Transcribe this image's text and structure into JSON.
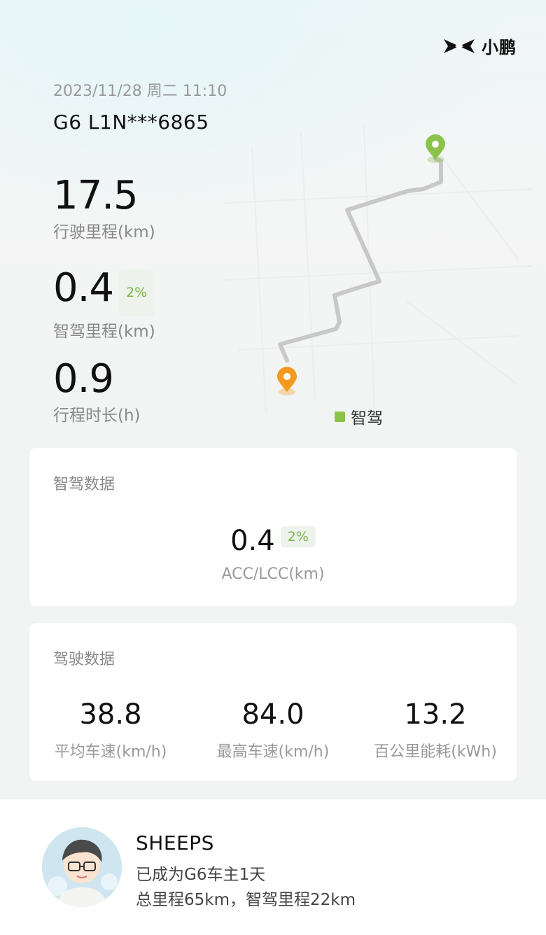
{
  "brand": {
    "name": "小鹏"
  },
  "trip": {
    "datetime": "2023/11/28 周二 11:10",
    "plate": "G6 L1N***6865",
    "mileage_value": "17.5",
    "mileage_label": "行驶里程(km)",
    "smart_value": "0.4",
    "smart_pct": "2%",
    "smart_label": "智驾里程(km)",
    "duration_value": "0.9",
    "duration_label": "行程时长(h)",
    "legend_label": "智驾"
  },
  "smart_card": {
    "title": "智驾数据",
    "value": "0.4",
    "pct": "2%",
    "label": "ACC/LCC(km)"
  },
  "drive_card": {
    "title": "驾驶数据",
    "items": [
      {
        "value": "38.8",
        "label": "平均车速(km/h)"
      },
      {
        "value": "84.0",
        "label": "最高车速(km/h)"
      },
      {
        "value": "13.2",
        "label": "百公里能耗(kWh)"
      }
    ]
  },
  "user": {
    "name": "SHEEPS",
    "line1": "已成为G6车主1天",
    "line2": "总里程65km，智驾里程22km"
  },
  "colors": {
    "accent_green": "#8bc34a",
    "start_orange": "#f39a1e",
    "route_gray": "#c8c8c8"
  }
}
